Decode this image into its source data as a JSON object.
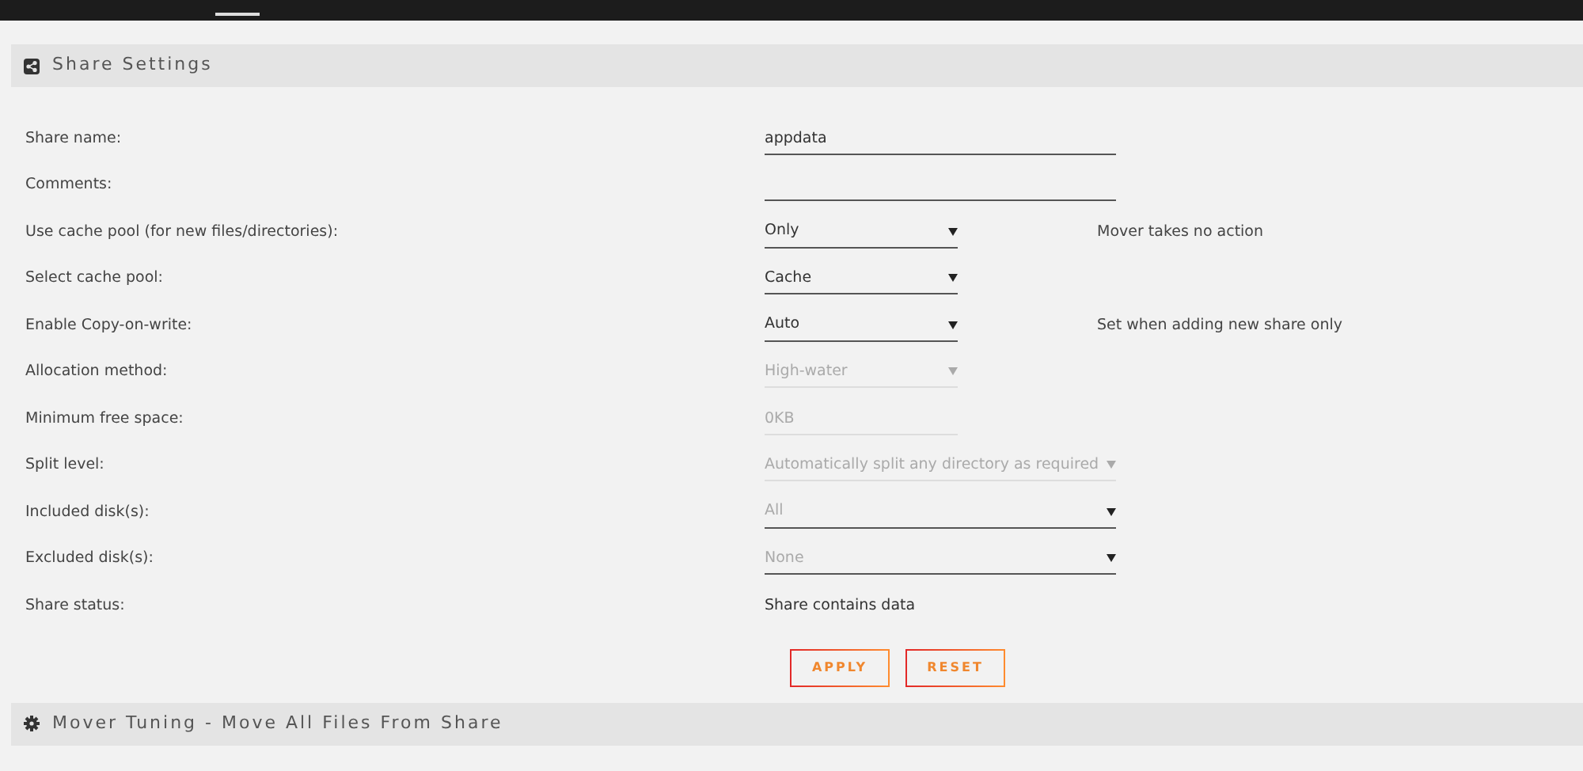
{
  "sections": [
    {
      "title": "Share Settings",
      "fields": [
        {
          "label": "Share name:",
          "kind": "text",
          "value": "appdata",
          "wide": true,
          "disabled": false
        },
        {
          "label": "Comments:",
          "kind": "text",
          "wide": true,
          "disabled": false
        },
        {
          "label": "Use cache pool (for new files/directories):",
          "kind": "select",
          "value": "Only",
          "wide": false,
          "disabled": false,
          "note": "Mover takes no action"
        },
        {
          "label": "Select cache pool:",
          "kind": "select",
          "value": "Cache",
          "wide": false,
          "disabled": false
        },
        {
          "label": "Enable Copy-on-write:",
          "kind": "select",
          "value": "Auto",
          "wide": false,
          "disabled": false,
          "note": "Set when adding new share only"
        },
        {
          "label": "Allocation method:",
          "kind": "select",
          "value": "High-water",
          "wide": false,
          "disabled": true
        },
        {
          "label": "Minimum free space:",
          "kind": "text",
          "value": "0KB",
          "wide": false,
          "disabled": true
        },
        {
          "label": "Split level:",
          "kind": "select",
          "value": "Automatically split any directory as required",
          "wide": true,
          "disabled": true
        },
        {
          "label": "Included disk(s):",
          "kind": "select",
          "placeholder": "All",
          "wide": true,
          "disabled": false
        },
        {
          "label": "Excluded disk(s):",
          "kind": "select",
          "placeholder": "None",
          "wide": true,
          "disabled": false
        },
        {
          "label": "Share status:",
          "kind": "static",
          "value": "Share contains data"
        }
      ],
      "buttons": [
        "APPLY",
        "RESET"
      ]
    },
    {
      "title": "Mover Tuning - Move All Files From Share"
    }
  ]
}
